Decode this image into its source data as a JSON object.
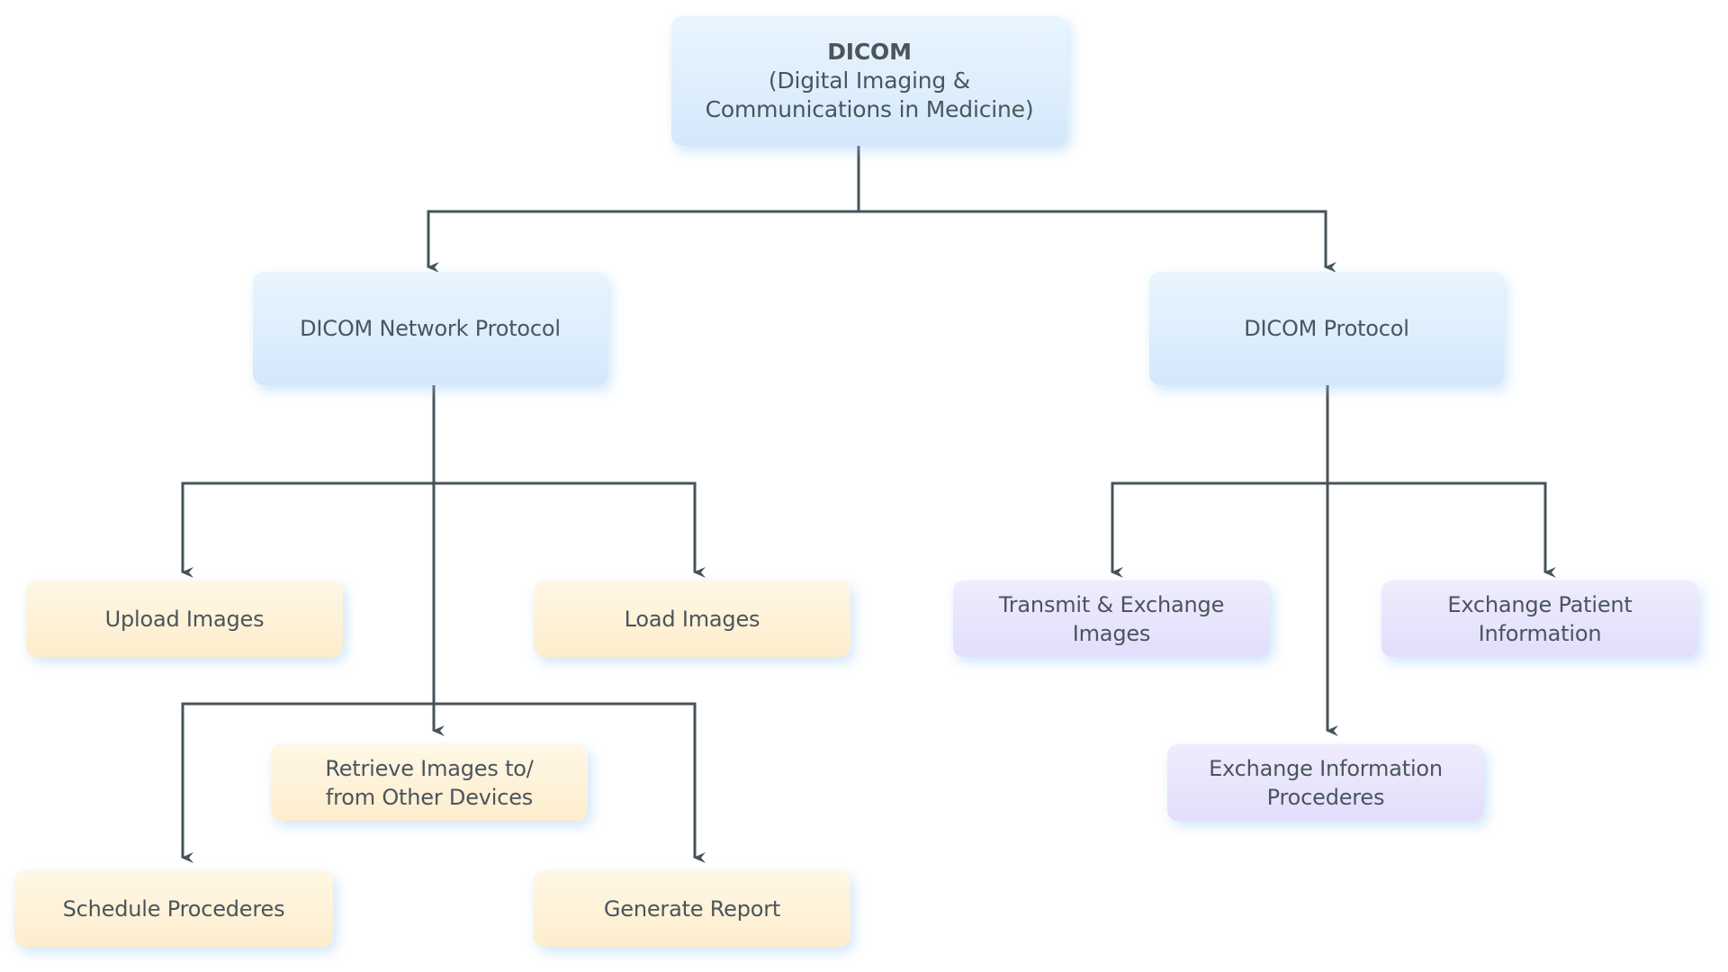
{
  "diagram": {
    "type": "hierarchy-flowchart",
    "colors": {
      "line": "#47535a",
      "text": "#4a555c",
      "level1_fill": "#dfeffd",
      "network_children_fill": "#fef2da",
      "protocol_children_fill": "#e8e5fc"
    },
    "root": {
      "title": "DICOM",
      "subtitle_line1": "(Digital Imaging &",
      "subtitle_line2": "Communications in Medicine)"
    },
    "network_protocol": {
      "label": "DICOM Network Protocol",
      "children": {
        "upload": "Upload Images",
        "load": "Load Images",
        "retrieve_line1": "Retrieve Images to/",
        "retrieve_line2": "from Other Devices",
        "schedule": "Schedule Procederes",
        "report": "Generate Report"
      }
    },
    "dicom_protocol": {
      "label": "DICOM Protocol",
      "children": {
        "transmit_line1": "Transmit & Exchange",
        "transmit_line2": "Images",
        "patient_line1": "Exchange Patient",
        "patient_line2": "Information",
        "procedures_line1": "Exchange Information",
        "procedures_line2": "Procederes"
      }
    },
    "edges": [
      [
        "DICOM",
        "DICOM Network Protocol"
      ],
      [
        "DICOM",
        "DICOM Protocol"
      ],
      [
        "DICOM Network Protocol",
        "Upload Images"
      ],
      [
        "DICOM Network Protocol",
        "Load Images"
      ],
      [
        "DICOM Network Protocol",
        "Retrieve Images to/from Other Devices"
      ],
      [
        "DICOM Network Protocol",
        "Schedule Procederes"
      ],
      [
        "DICOM Network Protocol",
        "Generate Report"
      ],
      [
        "DICOM Protocol",
        "Transmit & Exchange Images"
      ],
      [
        "DICOM Protocol",
        "Exchange Patient Information"
      ],
      [
        "DICOM Protocol",
        "Exchange Information Procederes"
      ]
    ]
  }
}
